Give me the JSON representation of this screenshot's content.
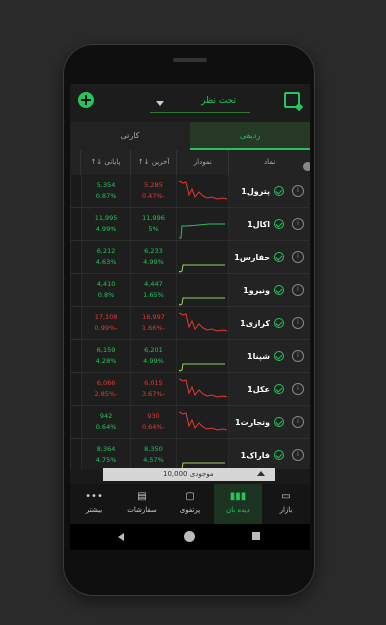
{
  "header": {
    "watchlist_label": "تحت نظر"
  },
  "tabs": [
    {
      "label": "ردیفی",
      "active": true
    },
    {
      "label": "کارتی",
      "active": false
    }
  ],
  "table": {
    "headers": {
      "symbol": "نماد",
      "chart": "نمودار",
      "last": "آخرین ↓↑",
      "close": "پایانی ↓↑"
    },
    "rows": [
      {
        "symbol": "پترول1",
        "last_price": "5,285",
        "last_pct": "-0.47%",
        "close_price": "5,354",
        "close_pct": "0.87%",
        "last_dir": "neg",
        "close_dir": "pos",
        "chart_color": "#e53935"
      },
      {
        "symbol": "اکال1",
        "last_price": "11,996",
        "last_pct": "5%",
        "close_price": "11,995",
        "close_pct": "4.99%",
        "last_dir": "pos",
        "close_dir": "pos",
        "chart_color": "#22c55e"
      },
      {
        "symbol": "حفارس1",
        "last_price": "6,233",
        "last_pct": "4.99%",
        "close_price": "6,212",
        "close_pct": "4.63%",
        "last_dir": "pos",
        "close_dir": "pos",
        "chart_color": "#9ccc65"
      },
      {
        "symbol": "ونیرو1",
        "last_price": "4,447",
        "last_pct": "1.65%",
        "close_price": "4,410",
        "close_pct": "0.8%",
        "last_dir": "pos",
        "close_dir": "pos",
        "chart_color": "#9ccc65"
      },
      {
        "symbol": "کرازی1",
        "last_price": "16,997",
        "last_pct": "-1.66%",
        "close_price": "17,108",
        "close_pct": "-0.99%",
        "last_dir": "neg",
        "close_dir": "neg",
        "chart_color": "#e53935"
      },
      {
        "symbol": "شپنا1",
        "last_price": "6,201",
        "last_pct": "4.99%",
        "close_price": "6,159",
        "close_pct": "4.28%",
        "last_dir": "pos",
        "close_dir": "pos",
        "chart_color": "#9ccc65"
      },
      {
        "symbol": "عکل1",
        "last_price": "6,015",
        "last_pct": "-3.67%",
        "close_price": "6,066",
        "close_pct": "-2.85%",
        "last_dir": "neg",
        "close_dir": "neg",
        "chart_color": "#e53935"
      },
      {
        "symbol": "وتجارت1",
        "last_price": "930",
        "last_pct": "-0.64%",
        "close_price": "942",
        "close_pct": "0.64%",
        "last_dir": "neg",
        "close_dir": "pos",
        "chart_color": "#e53935"
      },
      {
        "symbol": "فاراک1",
        "last_price": "8,350",
        "last_pct": "4.57%",
        "close_price": "8,364",
        "close_pct": "4.75%",
        "last_dir": "pos",
        "close_dir": "pos",
        "chart_color": "#9ccc65"
      }
    ]
  },
  "inventory": {
    "label": "موجودی 10,000"
  },
  "nav": [
    {
      "label": "بازار",
      "icon": "market-icon",
      "active": false
    },
    {
      "label": "دیده بان",
      "icon": "watch-icon",
      "active": true
    },
    {
      "label": "پرتفوی",
      "icon": "portfolio-icon",
      "active": false
    },
    {
      "label": "سفارشات",
      "icon": "orders-icon",
      "active": false
    },
    {
      "label": "بیشتر",
      "icon": "more-icon",
      "active": false
    }
  ],
  "colors": {
    "accent": "#22c55e",
    "negative": "#e53935",
    "positive": "#22c55e"
  }
}
